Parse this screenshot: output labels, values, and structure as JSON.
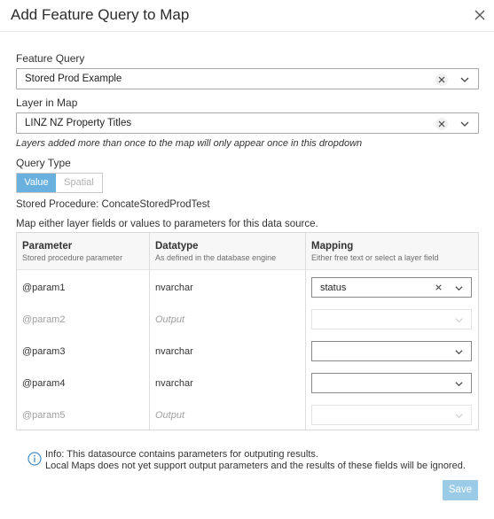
{
  "dialog": {
    "title": "Add Feature Query to Map",
    "close_icon": "close-icon"
  },
  "feature_query": {
    "label": "Feature Query",
    "value": "Stored Prod Example"
  },
  "layer": {
    "label": "Layer in Map",
    "value": "LINZ NZ Property Titles",
    "hint": "Layers added more than once to the map will only appear once in this dropdown"
  },
  "query_type": {
    "label": "Query Type",
    "options": [
      "Value",
      "Spatial"
    ],
    "selected": "Value"
  },
  "stored_procedure": "Stored Procedure: ConcateStoredProdTest",
  "mapping_instructions": "Map either layer fields or values to parameters for this data source.",
  "table": {
    "headers": [
      {
        "title": "Parameter",
        "subtitle": "Stored procedure parameter"
      },
      {
        "title": "Datatype",
        "subtitle": "As defined in the database engine"
      },
      {
        "title": "Mapping",
        "subtitle": "Either free text or select a layer field"
      }
    ],
    "rows": [
      {
        "param": "@param1",
        "datatype": "nvarchar",
        "mapping": "status",
        "disabled": false
      },
      {
        "param": "@param2",
        "datatype": "Output",
        "mapping": "",
        "disabled": true
      },
      {
        "param": "@param3",
        "datatype": "nvarchar",
        "mapping": "",
        "disabled": false
      },
      {
        "param": "@param4",
        "datatype": "nvarchar",
        "mapping": "",
        "disabled": false
      },
      {
        "param": "@param5",
        "datatype": "Output",
        "mapping": "",
        "disabled": true
      }
    ]
  },
  "info": {
    "line1": "Info: This datasource contains parameters for outputing results.",
    "line2": "Local Maps does not yet support output parameters and the results of these fields will be ignored."
  },
  "save_label": "Save",
  "colors": {
    "accent": "#6ab0de",
    "save_disabled": "#9ccbe8",
    "info_icon": "#4a90c9"
  }
}
